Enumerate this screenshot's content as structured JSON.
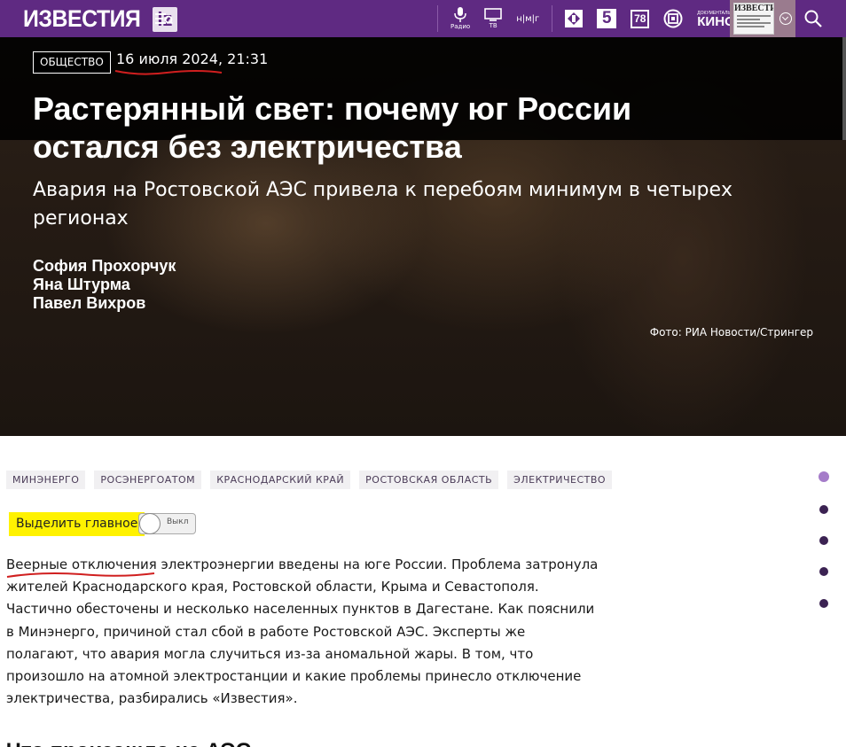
{
  "header": {
    "logo_text": "ИЗВЕСТИЯ",
    "logo_badge": "iz",
    "nav": [
      {
        "name": "radio",
        "caption": "Радио"
      },
      {
        "name": "tv",
        "caption": "ТВ"
      },
      {
        "name": "nmg",
        "label": "н|м|г"
      },
      {
        "name": "channel-ren",
        "label": ""
      },
      {
        "name": "channel-5",
        "label": "5"
      },
      {
        "name": "channel-78",
        "label": "78"
      },
      {
        "name": "channel-sport",
        "label": ""
      },
      {
        "name": "doc-kino",
        "small": "ДОКУМЕНТАЛЬНОЕ",
        "label": "КИНО"
      }
    ],
    "paper_title": "ИЗВЕСТИЯ"
  },
  "article": {
    "rubric": "Общество",
    "date": "16 июля 2024",
    "time": ", 21:31",
    "headline": "Растерянный свет: почему юг России остался без электричества",
    "subhead": "Авария на Ростовской АЭС привела к перебоям минимум в четырех регионах",
    "authors": [
      "София Прохорчук",
      "Яна Штурма",
      "Павел Вихров"
    ],
    "photo_credit": "Фото: РИА Новости/Стрингер",
    "tags": [
      "Минэнерго",
      "Росэнергоатом",
      "Краснодарский край",
      "Ростовская область",
      "Электричество"
    ],
    "highlight_label": "Выделить главное",
    "toggle_label": "Выкл",
    "lead": "Веерные отключения электроэнергии введены на юге России. Проблема затронула жителей Краснодарского края, Ростовской области, Крыма и Севастополя. Частично обесточены и несколько населенных пунктов в Дагестане. Как пояснили в Минэнерго, причиной стал сбой в работе Ростовской АЭС. Эксперты же полагают, что авария могла случиться из-за аномальной жары. В том, что произошло на атомной электростанции и какие проблемы принесло отключение электричества, разбирались «Известия».",
    "next_heading": "Что произошло на АЭС"
  },
  "colors": {
    "brand": "#5f2a82",
    "highlight": "#fff200",
    "annotation": "#d01f1f",
    "dot_active": "#a57cc9"
  }
}
